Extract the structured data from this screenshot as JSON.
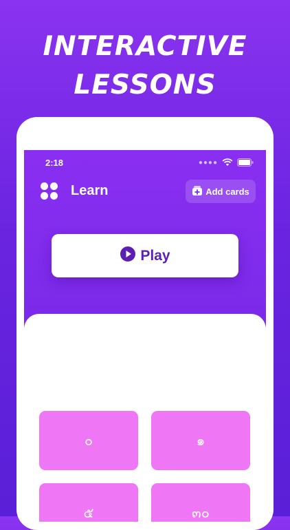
{
  "headline": {
    "line1": "INTERACTIVE",
    "line2": "LESSONS"
  },
  "status_bar": {
    "time": "2:18",
    "signal_icon": "signal-dots-icon",
    "wifi_icon": "wifi-icon",
    "battery_icon": "battery-icon"
  },
  "header": {
    "menu_icon": "grid-dots-icon",
    "title": "Learn",
    "add_cards_icon": "add-cards-icon",
    "add_cards_label": "Add cards"
  },
  "play": {
    "icon": "play-circle-icon",
    "label": "Play"
  },
  "cards": [
    {
      "glyph": "๐"
    },
    {
      "glyph": "๑"
    },
    {
      "glyph": "๕"
    },
    {
      "glyph": "๓๐"
    }
  ],
  "colors": {
    "background": "#7a2de8",
    "accent_purple": "#5b1fb3",
    "card_pink": "#ef77f5"
  }
}
